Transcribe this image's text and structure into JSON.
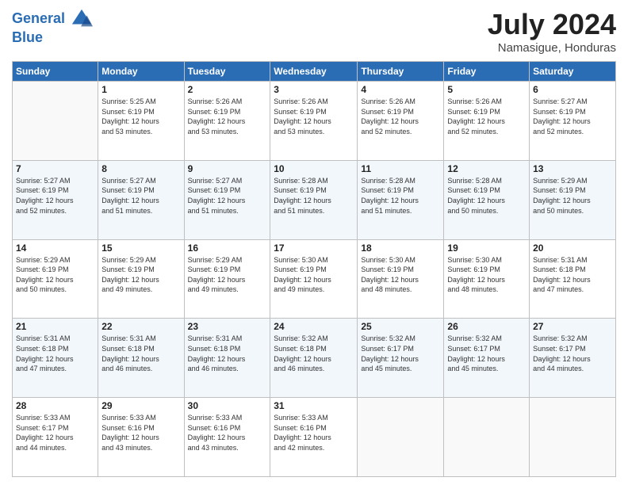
{
  "header": {
    "logo_line1": "General",
    "logo_line2": "Blue",
    "month": "July 2024",
    "location": "Namasigue, Honduras"
  },
  "weekdays": [
    "Sunday",
    "Monday",
    "Tuesday",
    "Wednesday",
    "Thursday",
    "Friday",
    "Saturday"
  ],
  "weeks": [
    [
      {
        "day": "",
        "info": ""
      },
      {
        "day": "1",
        "info": "Sunrise: 5:25 AM\nSunset: 6:19 PM\nDaylight: 12 hours\nand 53 minutes."
      },
      {
        "day": "2",
        "info": "Sunrise: 5:26 AM\nSunset: 6:19 PM\nDaylight: 12 hours\nand 53 minutes."
      },
      {
        "day": "3",
        "info": "Sunrise: 5:26 AM\nSunset: 6:19 PM\nDaylight: 12 hours\nand 53 minutes."
      },
      {
        "day": "4",
        "info": "Sunrise: 5:26 AM\nSunset: 6:19 PM\nDaylight: 12 hours\nand 52 minutes."
      },
      {
        "day": "5",
        "info": "Sunrise: 5:26 AM\nSunset: 6:19 PM\nDaylight: 12 hours\nand 52 minutes."
      },
      {
        "day": "6",
        "info": "Sunrise: 5:27 AM\nSunset: 6:19 PM\nDaylight: 12 hours\nand 52 minutes."
      }
    ],
    [
      {
        "day": "7",
        "info": "Sunrise: 5:27 AM\nSunset: 6:19 PM\nDaylight: 12 hours\nand 52 minutes."
      },
      {
        "day": "8",
        "info": "Sunrise: 5:27 AM\nSunset: 6:19 PM\nDaylight: 12 hours\nand 51 minutes."
      },
      {
        "day": "9",
        "info": "Sunrise: 5:27 AM\nSunset: 6:19 PM\nDaylight: 12 hours\nand 51 minutes."
      },
      {
        "day": "10",
        "info": "Sunrise: 5:28 AM\nSunset: 6:19 PM\nDaylight: 12 hours\nand 51 minutes."
      },
      {
        "day": "11",
        "info": "Sunrise: 5:28 AM\nSunset: 6:19 PM\nDaylight: 12 hours\nand 51 minutes."
      },
      {
        "day": "12",
        "info": "Sunrise: 5:28 AM\nSunset: 6:19 PM\nDaylight: 12 hours\nand 50 minutes."
      },
      {
        "day": "13",
        "info": "Sunrise: 5:29 AM\nSunset: 6:19 PM\nDaylight: 12 hours\nand 50 minutes."
      }
    ],
    [
      {
        "day": "14",
        "info": "Sunrise: 5:29 AM\nSunset: 6:19 PM\nDaylight: 12 hours\nand 50 minutes."
      },
      {
        "day": "15",
        "info": "Sunrise: 5:29 AM\nSunset: 6:19 PM\nDaylight: 12 hours\nand 49 minutes."
      },
      {
        "day": "16",
        "info": "Sunrise: 5:29 AM\nSunset: 6:19 PM\nDaylight: 12 hours\nand 49 minutes."
      },
      {
        "day": "17",
        "info": "Sunrise: 5:30 AM\nSunset: 6:19 PM\nDaylight: 12 hours\nand 49 minutes."
      },
      {
        "day": "18",
        "info": "Sunrise: 5:30 AM\nSunset: 6:19 PM\nDaylight: 12 hours\nand 48 minutes."
      },
      {
        "day": "19",
        "info": "Sunrise: 5:30 AM\nSunset: 6:19 PM\nDaylight: 12 hours\nand 48 minutes."
      },
      {
        "day": "20",
        "info": "Sunrise: 5:31 AM\nSunset: 6:18 PM\nDaylight: 12 hours\nand 47 minutes."
      }
    ],
    [
      {
        "day": "21",
        "info": "Sunrise: 5:31 AM\nSunset: 6:18 PM\nDaylight: 12 hours\nand 47 minutes."
      },
      {
        "day": "22",
        "info": "Sunrise: 5:31 AM\nSunset: 6:18 PM\nDaylight: 12 hours\nand 46 minutes."
      },
      {
        "day": "23",
        "info": "Sunrise: 5:31 AM\nSunset: 6:18 PM\nDaylight: 12 hours\nand 46 minutes."
      },
      {
        "day": "24",
        "info": "Sunrise: 5:32 AM\nSunset: 6:18 PM\nDaylight: 12 hours\nand 46 minutes."
      },
      {
        "day": "25",
        "info": "Sunrise: 5:32 AM\nSunset: 6:17 PM\nDaylight: 12 hours\nand 45 minutes."
      },
      {
        "day": "26",
        "info": "Sunrise: 5:32 AM\nSunset: 6:17 PM\nDaylight: 12 hours\nand 45 minutes."
      },
      {
        "day": "27",
        "info": "Sunrise: 5:32 AM\nSunset: 6:17 PM\nDaylight: 12 hours\nand 44 minutes."
      }
    ],
    [
      {
        "day": "28",
        "info": "Sunrise: 5:33 AM\nSunset: 6:17 PM\nDaylight: 12 hours\nand 44 minutes."
      },
      {
        "day": "29",
        "info": "Sunrise: 5:33 AM\nSunset: 6:16 PM\nDaylight: 12 hours\nand 43 minutes."
      },
      {
        "day": "30",
        "info": "Sunrise: 5:33 AM\nSunset: 6:16 PM\nDaylight: 12 hours\nand 43 minutes."
      },
      {
        "day": "31",
        "info": "Sunrise: 5:33 AM\nSunset: 6:16 PM\nDaylight: 12 hours\nand 42 minutes."
      },
      {
        "day": "",
        "info": ""
      },
      {
        "day": "",
        "info": ""
      },
      {
        "day": "",
        "info": ""
      }
    ]
  ]
}
